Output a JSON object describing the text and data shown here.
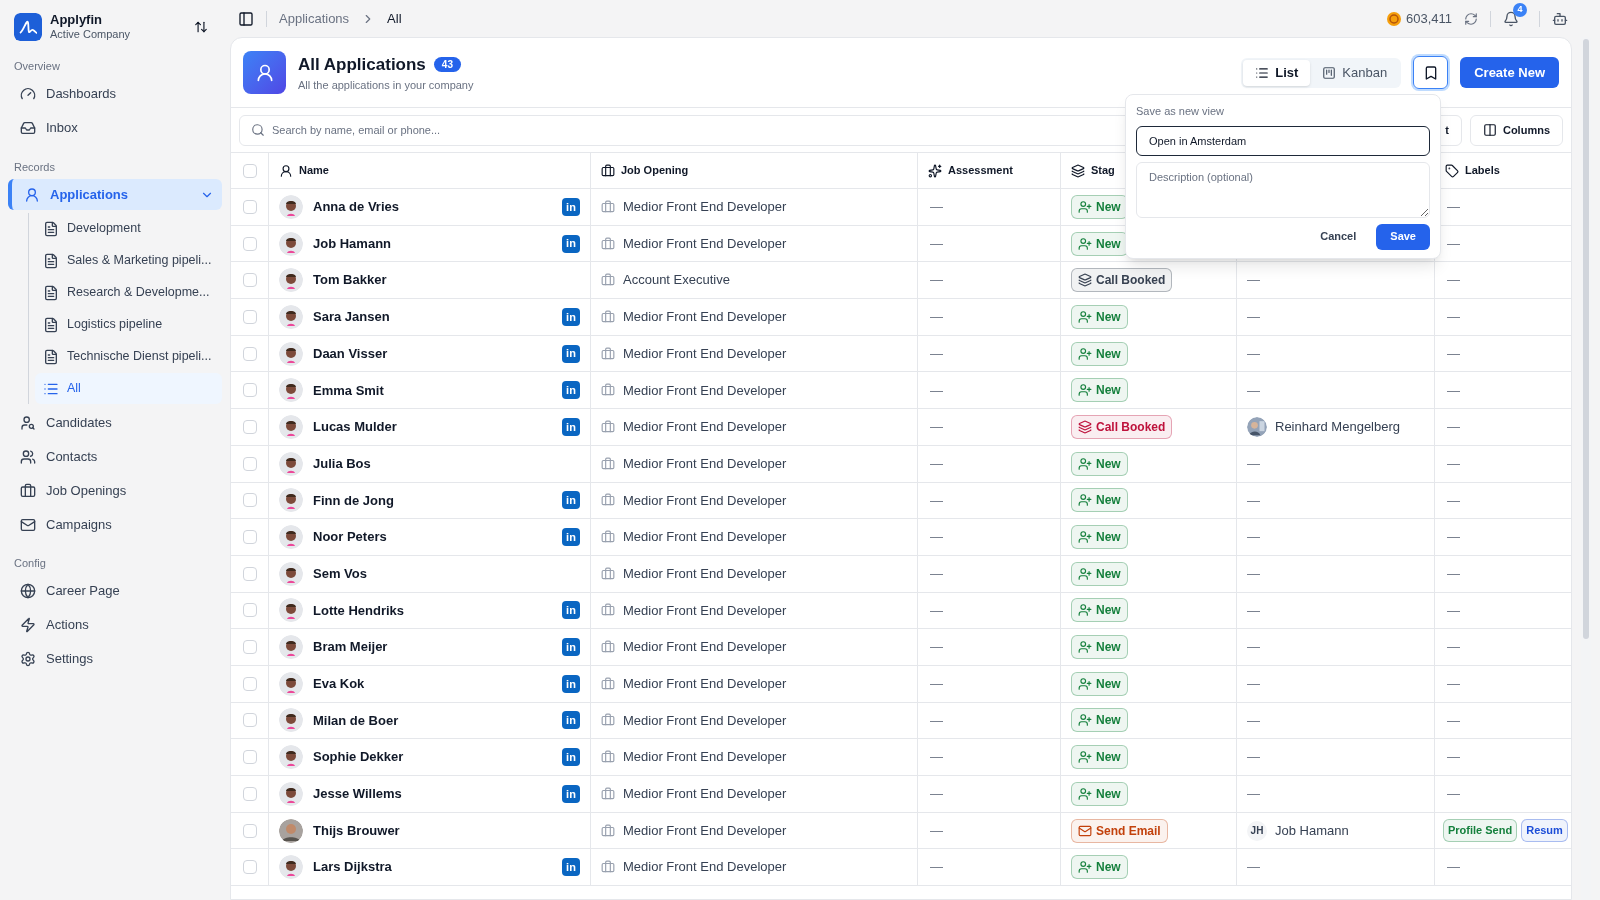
{
  "company": {
    "name": "Applyfin",
    "subtitle": "Active Company"
  },
  "sidebar": {
    "sections": [
      {
        "title": "Overview",
        "items": [
          {
            "label": "Dashboards",
            "selected": false
          },
          {
            "label": "Inbox",
            "selected": false
          }
        ]
      },
      {
        "title": "Records",
        "items": [
          {
            "label": "Applications",
            "selected": true,
            "expanded": true,
            "children": [
              {
                "label": "Development",
                "selected": false
              },
              {
                "label": "Sales & Marketing pipeli...",
                "selected": false
              },
              {
                "label": "Research & Developme...",
                "selected": false
              },
              {
                "label": "Logistics pipeline",
                "selected": false
              },
              {
                "label": "Technische Dienst pipeli...",
                "selected": false
              },
              {
                "label": "All",
                "selected": true
              }
            ]
          },
          {
            "label": "Candidates",
            "selected": false
          },
          {
            "label": "Contacts",
            "selected": false
          },
          {
            "label": "Job Openings",
            "selected": false
          },
          {
            "label": "Campaigns",
            "selected": false
          }
        ]
      },
      {
        "title": "Config",
        "items": [
          {
            "label": "Career Page",
            "selected": false
          },
          {
            "label": "Actions",
            "selected": false
          },
          {
            "label": "Settings",
            "selected": false
          }
        ]
      }
    ]
  },
  "breadcrumb": [
    "Applications",
    "All"
  ],
  "credits": "603,411",
  "notifications": "4",
  "page": {
    "title": "All Applications",
    "count": "43",
    "subtitle": "All the applications in your company"
  },
  "view_toggle": [
    {
      "label": "List",
      "selected": true
    },
    {
      "label": "Kanban",
      "selected": false
    }
  ],
  "bookmark_active": true,
  "create_button": "Create New",
  "search": {
    "placeholder": "Search by name, email or phone..."
  },
  "select_all_checked": false,
  "toolbar_buttons": [
    "t",
    "Columns"
  ],
  "popup": {
    "title": "Save as new view",
    "name_value": "Open in Amsterdam",
    "description_placeholder": "Description (optional)",
    "cancel": "Cancel",
    "save": "Save"
  },
  "table": {
    "columns": [
      "Name",
      "Job Opening",
      "Assessment",
      "Stag",
      "Labels"
    ],
    "rows": [
      {
        "checked": false,
        "name": "Anna de Vries",
        "social": "in",
        "job": "Medior Front End Developer",
        "assessment": "—",
        "stage": {
          "kind": "new",
          "label": "New",
          "color": "#15803d"
        },
        "labels": [
          {
            "text": "—",
            "kind": "empty"
          }
        ]
      },
      {
        "checked": false,
        "name": "Job Hamann",
        "social": "in",
        "job": "Medior Front End Developer",
        "assessment": "—",
        "stage": {
          "kind": "new",
          "label": "New",
          "color": "#15803d"
        },
        "labels": [
          {
            "text": "—",
            "kind": "empty"
          }
        ]
      },
      {
        "checked": false,
        "name": "Tom Bakker",
        "job": "Account Executive",
        "assessment": "—",
        "stage": {
          "kind": "call",
          "label": "Call Booked",
          "color": "#374151"
        },
        "assignee": {
          "kind": "none",
          "text": "—"
        },
        "labels": [
          {
            "text": "—",
            "kind": "empty"
          }
        ]
      },
      {
        "checked": false,
        "name": "Sara Jansen",
        "social": "in",
        "job": "Medior Front End Developer",
        "assessment": "—",
        "stage": {
          "kind": "new",
          "label": "New",
          "color": "#15803d"
        },
        "assignee": {
          "kind": "none",
          "text": "—"
        },
        "labels": [
          {
            "text": "—",
            "kind": "empty"
          }
        ]
      },
      {
        "checked": false,
        "name": "Daan Visser",
        "social": "in",
        "job": "Medior Front End Developer",
        "assessment": "—",
        "stage": {
          "kind": "new",
          "label": "New",
          "color": "#15803d"
        },
        "assignee": {
          "kind": "none",
          "text": "—"
        },
        "labels": [
          {
            "text": "—",
            "kind": "empty"
          }
        ]
      },
      {
        "checked": false,
        "name": "Emma Smit",
        "social": "in",
        "job": "Medior Front End Developer",
        "assessment": "—",
        "stage": {
          "kind": "new",
          "label": "New",
          "color": "#15803d"
        },
        "assignee": {
          "kind": "none",
          "text": "—"
        },
        "labels": [
          {
            "text": "—",
            "kind": "empty"
          }
        ]
      },
      {
        "checked": false,
        "name": "Lucas Mulder",
        "social": "in",
        "job": "Medior Front End Developer",
        "assessment": "—",
        "stage": {
          "kind": "call",
          "label": "Call Booked",
          "color": "#be123c"
        },
        "assignee": {
          "kind": "photo",
          "text": "Reinhard Mengelberg"
        },
        "labels": [
          {
            "text": "—",
            "kind": "empty"
          }
        ]
      },
      {
        "checked": false,
        "name": "Julia Bos",
        "job": "Medior Front End Developer",
        "assessment": "—",
        "stage": {
          "kind": "new",
          "label": "New",
          "color": "#15803d"
        },
        "assignee": {
          "kind": "none",
          "text": "—"
        },
        "labels": [
          {
            "text": "—",
            "kind": "empty"
          }
        ]
      },
      {
        "checked": false,
        "name": "Finn de Jong",
        "social": "in",
        "job": "Medior Front End Developer",
        "assessment": "—",
        "stage": {
          "kind": "new",
          "label": "New",
          "color": "#15803d"
        },
        "assignee": {
          "kind": "none",
          "text": "—"
        },
        "labels": [
          {
            "text": "—",
            "kind": "empty"
          }
        ]
      },
      {
        "checked": false,
        "name": "Noor Peters",
        "social": "in",
        "job": "Medior Front End Developer",
        "assessment": "—",
        "stage": {
          "kind": "new",
          "label": "New",
          "color": "#15803d"
        },
        "assignee": {
          "kind": "none",
          "text": "—"
        },
        "labels": [
          {
            "text": "—",
            "kind": "empty"
          }
        ]
      },
      {
        "checked": false,
        "name": "Sem Vos",
        "job": "Medior Front End Developer",
        "assessment": "—",
        "stage": {
          "kind": "new",
          "label": "New",
          "color": "#15803d"
        },
        "assignee": {
          "kind": "none",
          "text": "—"
        },
        "labels": [
          {
            "text": "—",
            "kind": "empty"
          }
        ]
      },
      {
        "checked": false,
        "name": "Lotte Hendriks",
        "social": "in",
        "job": "Medior Front End Developer",
        "assessment": "—",
        "stage": {
          "kind": "new",
          "label": "New",
          "color": "#15803d"
        },
        "assignee": {
          "kind": "none",
          "text": "—"
        },
        "labels": [
          {
            "text": "—",
            "kind": "empty"
          }
        ]
      },
      {
        "checked": false,
        "name": "Bram Meijer",
        "social": "in",
        "job": "Medior Front End Developer",
        "assessment": "—",
        "stage": {
          "kind": "new",
          "label": "New",
          "color": "#15803d"
        },
        "assignee": {
          "kind": "none",
          "text": "—"
        },
        "labels": [
          {
            "text": "—",
            "kind": "empty"
          }
        ]
      },
      {
        "checked": false,
        "name": "Eva Kok",
        "social": "in",
        "job": "Medior Front End Developer",
        "assessment": "—",
        "stage": {
          "kind": "new",
          "label": "New",
          "color": "#15803d"
        },
        "assignee": {
          "kind": "none",
          "text": "—"
        },
        "labels": [
          {
            "text": "—",
            "kind": "empty"
          }
        ]
      },
      {
        "checked": false,
        "name": "Milan de Boer",
        "social": "in",
        "job": "Medior Front End Developer",
        "assessment": "—",
        "stage": {
          "kind": "new",
          "label": "New",
          "color": "#15803d"
        },
        "assignee": {
          "kind": "none",
          "text": "—"
        },
        "labels": [
          {
            "text": "—",
            "kind": "empty"
          }
        ]
      },
      {
        "checked": false,
        "name": "Sophie Dekker",
        "social": "in",
        "job": "Medior Front End Developer",
        "assessment": "—",
        "stage": {
          "kind": "new",
          "label": "New",
          "color": "#15803d"
        },
        "assignee": {
          "kind": "none",
          "text": "—"
        },
        "labels": [
          {
            "text": "—",
            "kind": "empty"
          }
        ]
      },
      {
        "checked": false,
        "name": "Jesse Willems",
        "social": "in",
        "job": "Medior Front End Developer",
        "assessment": "—",
        "stage": {
          "kind": "new",
          "label": "New",
          "color": "#15803d"
        },
        "assignee": {
          "kind": "none",
          "text": "—"
        },
        "labels": [
          {
            "text": "—",
            "kind": "empty"
          }
        ]
      },
      {
        "checked": false,
        "name": "Thijs Brouwer",
        "job": "Medior Front End Developer",
        "assessment": "—",
        "stage": {
          "kind": "email",
          "label": "Send Email",
          "color": "#c2410c"
        },
        "assignee": {
          "kind": "initials",
          "initials": "JH",
          "text": "Job Hamann"
        },
        "labels": [
          {
            "text": "Profile Send",
            "kind": "tag",
            "color": "#15803d"
          },
          {
            "text": "Resum",
            "kind": "tag",
            "color": "#1d4ed8"
          }
        ]
      },
      {
        "checked": false,
        "name": "Lars Dijkstra",
        "social": "in",
        "job": "Medior Front End Developer",
        "assessment": "—",
        "stage": {
          "kind": "new",
          "label": "New",
          "color": "#15803d"
        },
        "assignee": {
          "kind": "none",
          "text": "—"
        },
        "labels": [
          {
            "text": "—",
            "kind": "empty"
          }
        ]
      }
    ]
  }
}
